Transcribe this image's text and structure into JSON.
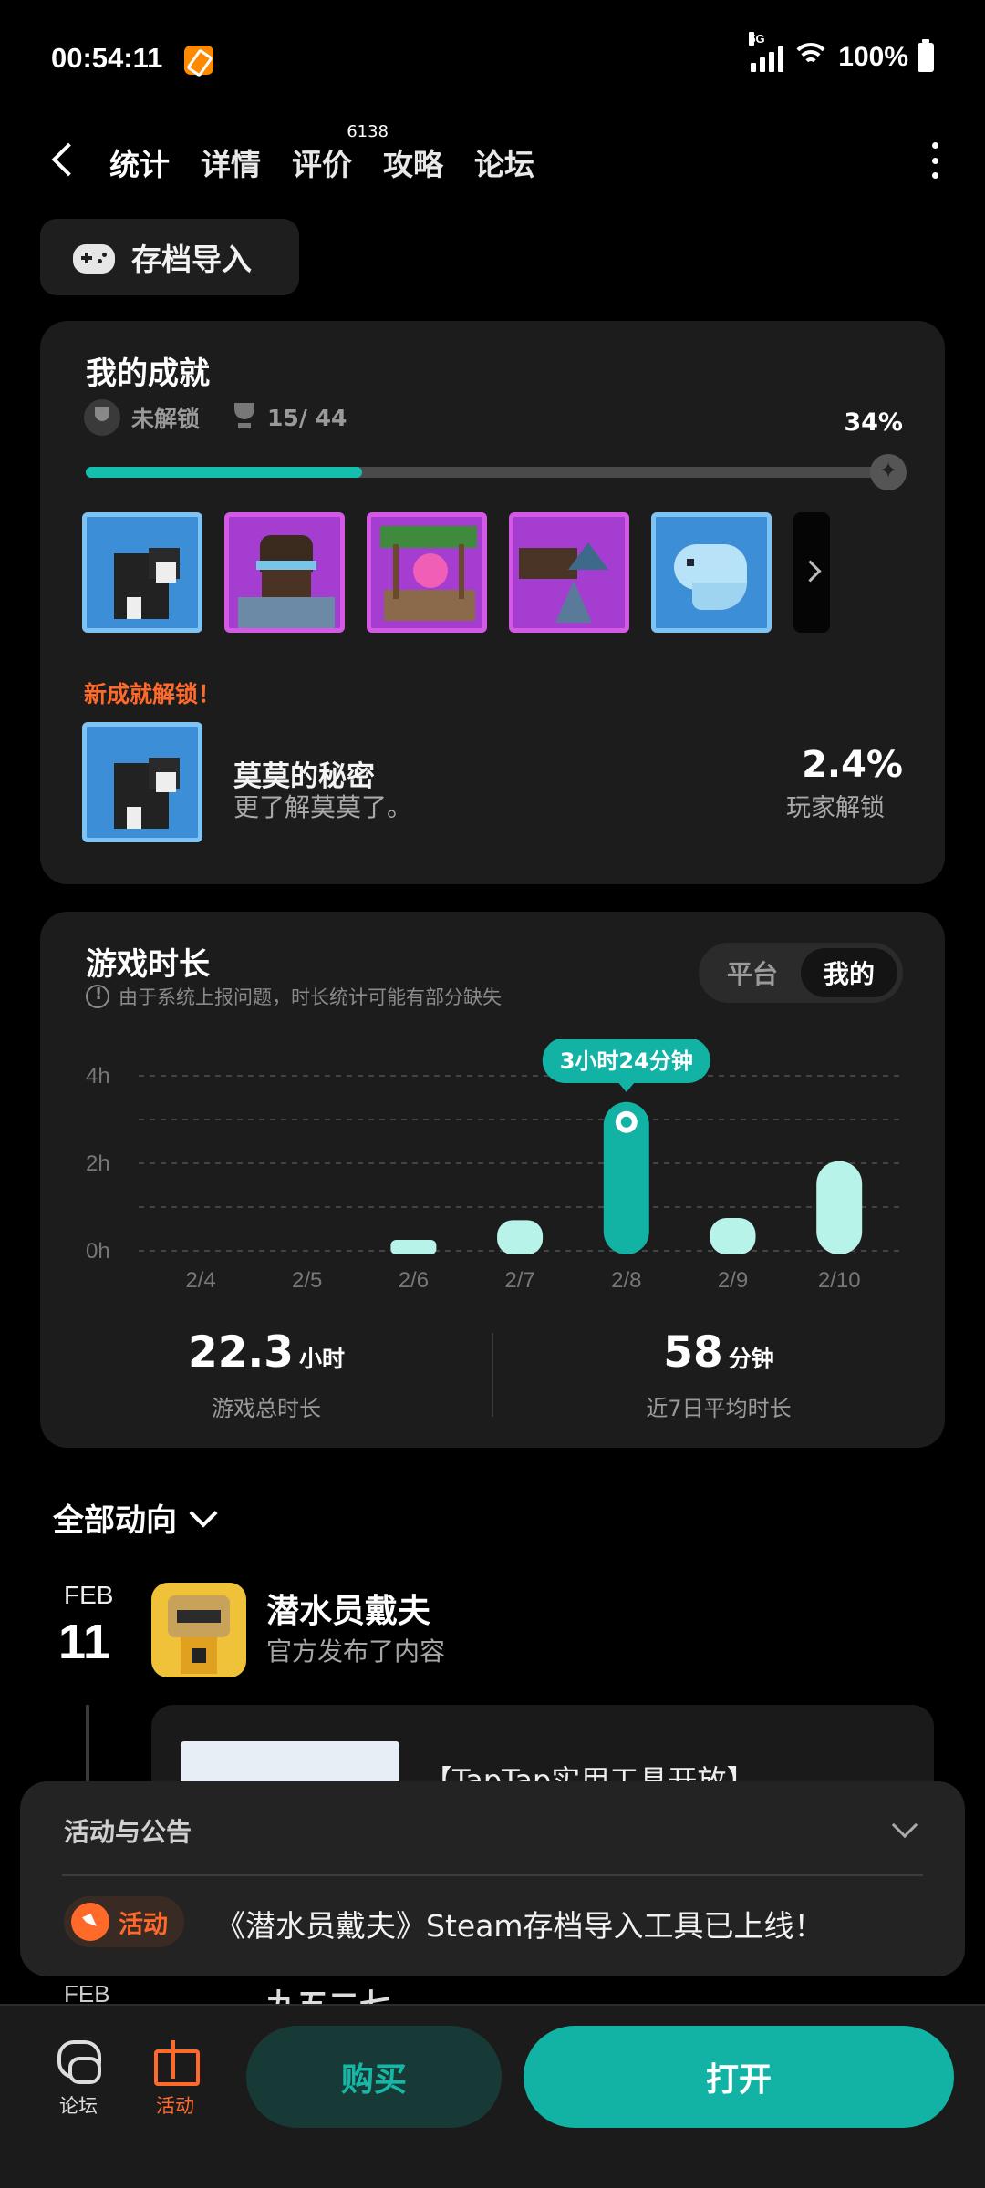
{
  "status_bar": {
    "time": "00:54:11",
    "network": "5G",
    "battery": "100%"
  },
  "nav": {
    "tabs": [
      {
        "label": "统计",
        "active": true
      },
      {
        "label": "详情"
      },
      {
        "label": "评价",
        "badge": "6138"
      },
      {
        "label": "攻略"
      },
      {
        "label": "论坛"
      }
    ]
  },
  "import_button": {
    "label": "存档导入"
  },
  "achievements": {
    "title": "我的成就",
    "locked_label": "未解锁",
    "count": "15/ 44",
    "percent": "34%",
    "progress_fraction": 0.34,
    "new_label": "新成就解锁！",
    "new_achievement": {
      "name": "莫莫的秘密",
      "description": "更了解莫莫了。",
      "rate": "2.4%",
      "rate_label": "玩家解锁"
    }
  },
  "playtime": {
    "title": "游戏时长",
    "notice": "由于系统上报问题，时长统计可能有部分缺失",
    "toggle": {
      "platform": "平台",
      "mine": "我的"
    },
    "tooltip": "3小时24分钟",
    "total_value": "22.3",
    "total_unit": "小时",
    "total_label": "游戏总时长",
    "avg_value": "58",
    "avg_unit": "分钟",
    "avg_label": "近7日平均时长"
  },
  "chart_data": {
    "type": "bar",
    "categories": [
      "2/4",
      "2/5",
      "2/6",
      "2/7",
      "2/8",
      "2/9",
      "2/10"
    ],
    "values": [
      0,
      0,
      0.25,
      0.7,
      3.4,
      0.75,
      2.05
    ],
    "y_ticks": [
      "4h",
      "2h",
      "0h"
    ],
    "ylim": [
      0,
      4
    ],
    "highlight_index": 4,
    "colors": {
      "highlight": "#12b3a4",
      "normal": "#b8f3ea",
      "grid": "#444444"
    }
  },
  "feed": {
    "header": "全部动向",
    "month": "FEB",
    "day": "11",
    "name": "潜水员戴夫",
    "subtitle": "官方发布了内容",
    "card_text": "【TapTap实用工具开放】",
    "next_month": "FEB",
    "next_name": "九五二七"
  },
  "announcement": {
    "title": "活动与公告",
    "badge": "活动",
    "message": "《潜水员戴夫》Steam存档导入工具已上线！"
  },
  "bottom_bar": {
    "forum": "论坛",
    "events": "活动",
    "buy": "购买",
    "open": "打开"
  }
}
